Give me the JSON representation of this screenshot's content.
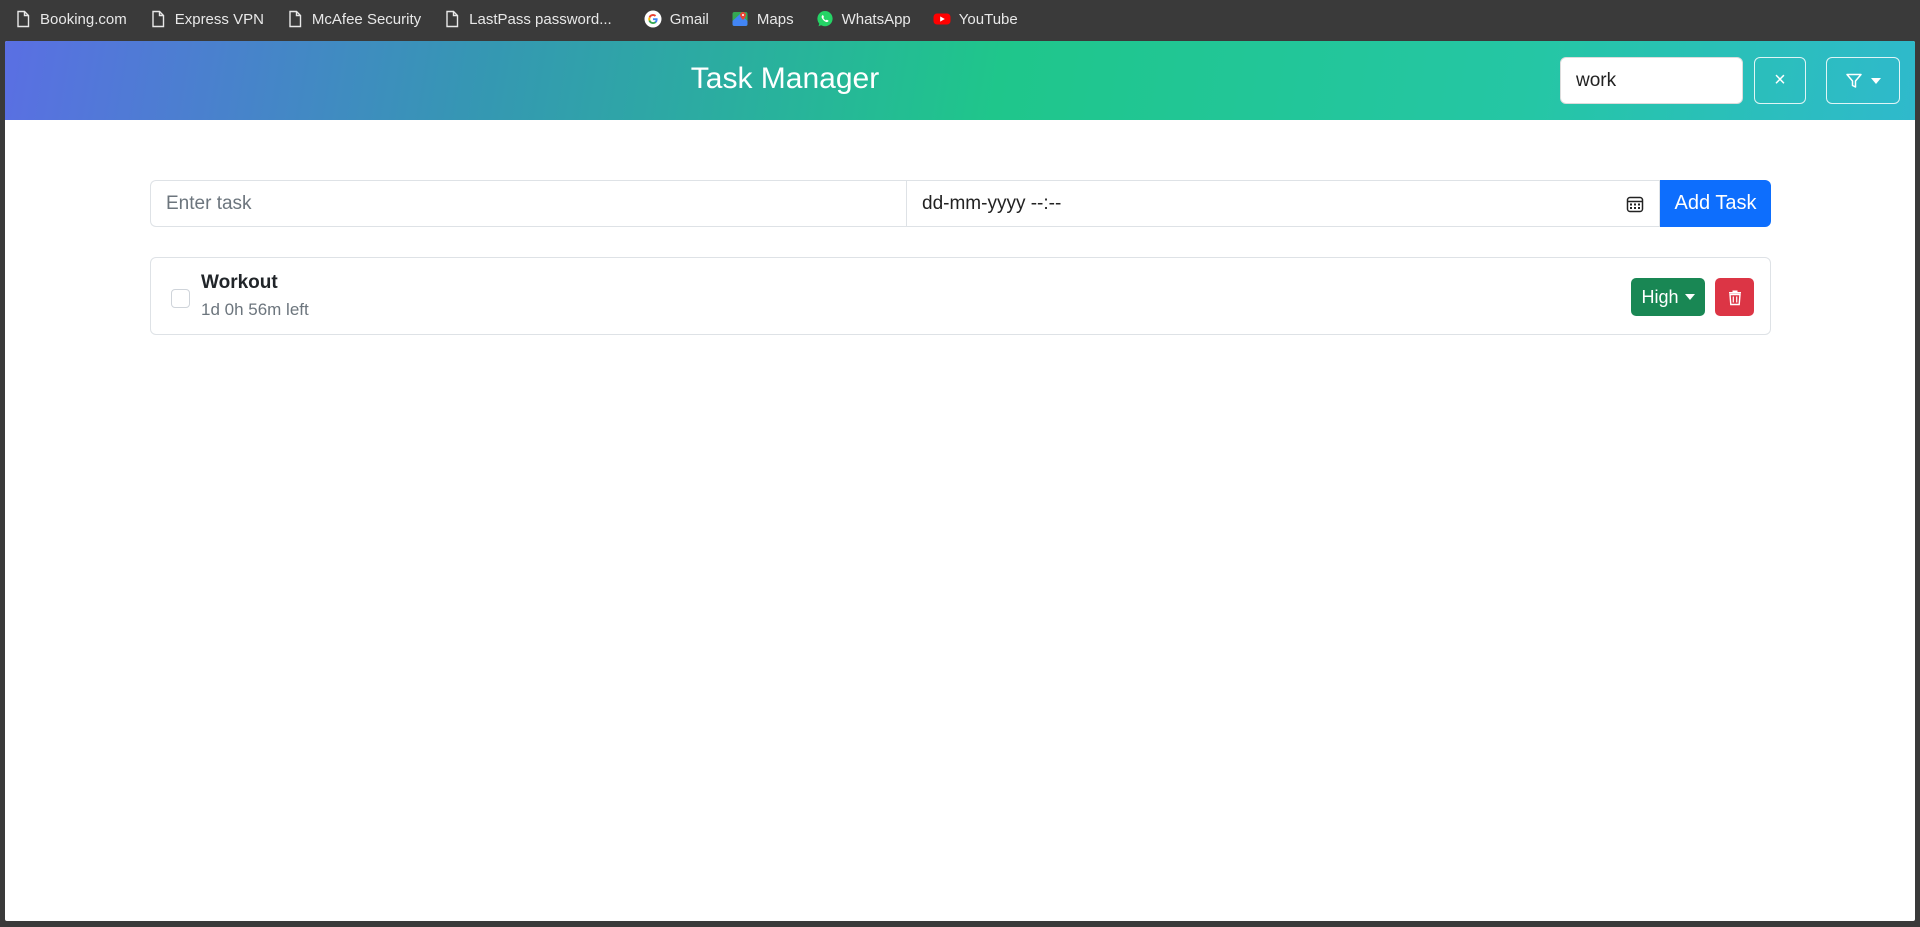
{
  "bookmarks": [
    {
      "label": "Booking.com",
      "icon": "document-icon"
    },
    {
      "label": "Express VPN",
      "icon": "document-icon"
    },
    {
      "label": "McAfee Security",
      "icon": "document-icon"
    },
    {
      "label": "LastPass password...",
      "icon": "document-icon"
    },
    {
      "label": "Gmail",
      "icon": "google-icon"
    },
    {
      "label": "Maps",
      "icon": "maps-icon"
    },
    {
      "label": "WhatsApp",
      "icon": "whatsapp-icon"
    },
    {
      "label": "YouTube",
      "icon": "youtube-icon"
    }
  ],
  "header": {
    "title": "Task Manager",
    "search_value": "work",
    "clear_label": "×",
    "filter_icon": "filter-icon"
  },
  "form": {
    "task_placeholder": "Enter task",
    "date_placeholder": "dd-mm-yyyy --:--",
    "add_label": "Add Task"
  },
  "tasks": [
    {
      "name": "Workout",
      "time_left": "1d 0h 56m left",
      "priority": "High",
      "done": false
    }
  ],
  "colors": {
    "primary": "#0d6efd",
    "priority_high": "#198754",
    "danger": "#dc3545"
  }
}
